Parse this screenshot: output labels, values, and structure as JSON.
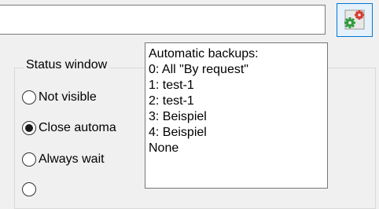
{
  "path_input": {
    "value": ""
  },
  "tool_button": {
    "icon": "gears-icon",
    "colors": {
      "red": "#d43b2e",
      "green": "#2e9b3b",
      "frame": "#0078d7"
    }
  },
  "status_window": {
    "title": "Status window",
    "options": [
      {
        "label": "Not visible",
        "selected": false
      },
      {
        "label": "Close automa",
        "selected": true
      },
      {
        "label": "Always wait",
        "selected": false
      }
    ]
  },
  "backup_dropdown": {
    "title": "Automatic backups:",
    "items": [
      "0: All \"By request\"",
      "1: test-1",
      "2: test-1",
      "3: Beispiel",
      "4: Beispiel",
      "None"
    ]
  }
}
